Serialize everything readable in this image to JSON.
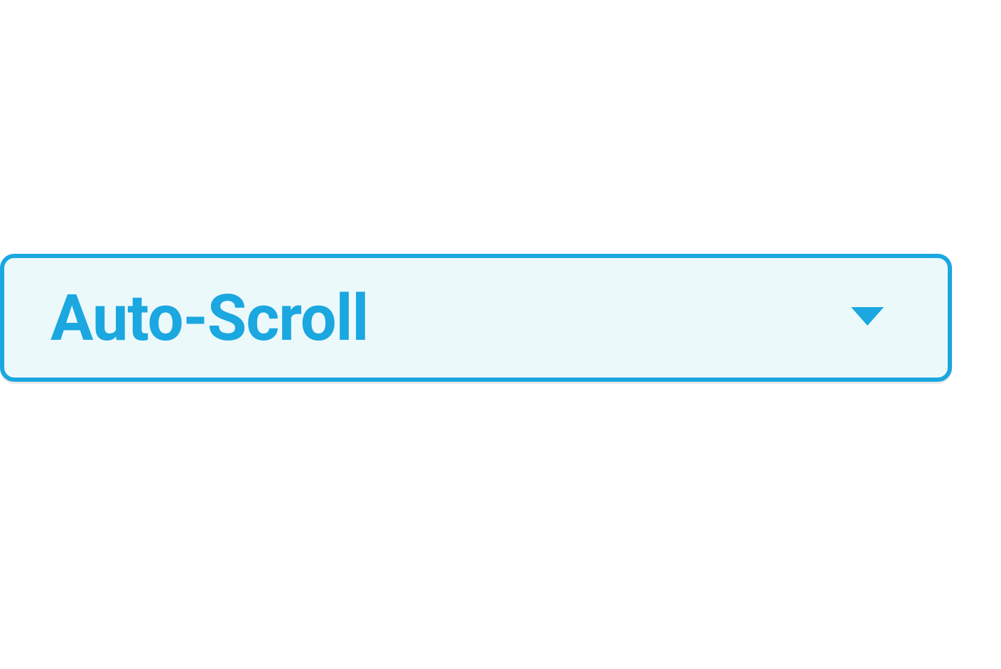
{
  "dropdown": {
    "label": "Auto-Scroll",
    "accent_color": "#1ba7e0",
    "background_color": "#ecf9fb",
    "icon": "caret-down"
  }
}
